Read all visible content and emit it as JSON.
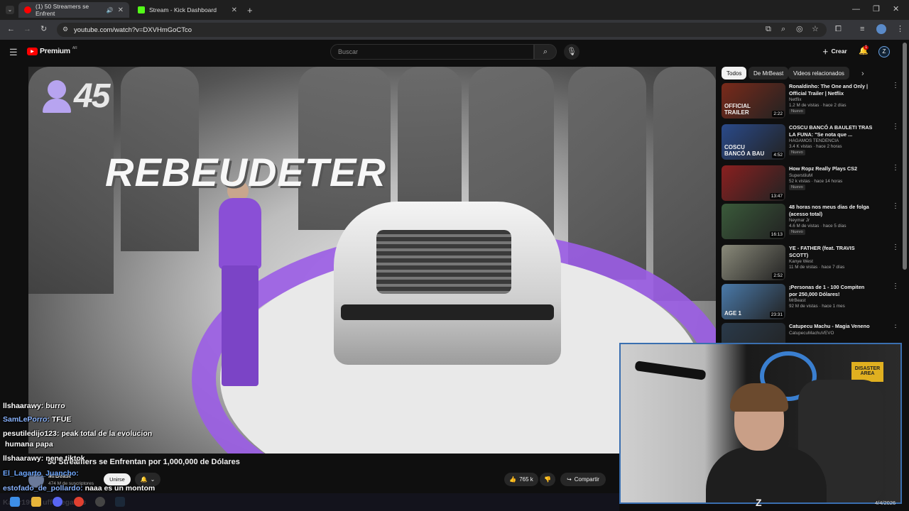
{
  "browser": {
    "tabs": [
      {
        "label": "(1) 50 Streamers se Enfrent",
        "active": true,
        "favicon_color": "#ff0000"
      },
      {
        "label": "Stream - Kick Dashboard",
        "active": false,
        "favicon_color": "#53fc18"
      }
    ],
    "url": "youtube.com/watch?v=DXVHmGoCTco"
  },
  "youtube": {
    "logo_text": "Premium",
    "logo_badge": "AR",
    "search_placeholder": "Buscar",
    "create_label": "Crear",
    "notification_count": "1"
  },
  "video_overlay": {
    "counter": "45",
    "title": "REBEUDETER"
  },
  "chips": [
    {
      "label": "Todos",
      "selected": true
    },
    {
      "label": "De MrBeast",
      "selected": false
    },
    {
      "label": "Videos relacionados",
      "selected": false
    }
  ],
  "recommendations": [
    {
      "title": "Ronaldinho: The One and Only | Official Trailer | Netflix",
      "channel": "Netflix",
      "meta": "1.2 M de vistas · hace 2 días",
      "badge": "Nuevo",
      "duration": "2:22",
      "thumb_text": "OFFICIAL TRAILER",
      "thumb_color": "#7a2a1a"
    },
    {
      "title": "COSCU BANCÓ A BAULETI TRAS LA FUNA: \"Se nota que ...",
      "channel": "HAGAMOS TENDENCIA",
      "meta": "3.4 K vistas · hace 2 horas",
      "badge": "Nuevo",
      "duration": "4:52",
      "thumb_text": "COSCU BANCÓ A BAU",
      "thumb_color": "#2a4a8a"
    },
    {
      "title": "How Ropz Really Plays CS2",
      "channel": "SuperstiluM",
      "meta": "52 k vistas · hace 14 horas",
      "badge": "Nuevo",
      "duration": "13:47",
      "thumb_text": "",
      "thumb_color": "#8a2020"
    },
    {
      "title": "48 horas nos meus dias de folga (acesso total)",
      "channel": "Neymar Jr",
      "meta": "4.6 M de vistas · hace 5 días",
      "badge": "Nuevo",
      "duration": "16:13",
      "thumb_text": "",
      "thumb_color": "#3a5a3a"
    },
    {
      "title": "YE - FATHER (feat. TRAVIS SCOTT)",
      "channel": "Kanye West",
      "meta": "11 M de vistas · hace 7 días",
      "badge": "",
      "duration": "2:52",
      "thumb_text": "",
      "thumb_color": "#8a8a7a"
    },
    {
      "title": "¡Personas de 1 - 100 Compiten por 250,000 Dólares!",
      "channel": "MrBeast",
      "meta": "92 M de vistas · hace 1 mes",
      "badge": "",
      "duration": "23:31",
      "thumb_text": "AGE 1",
      "thumb_color": "#4a7aaa"
    },
    {
      "title": "Catupecu Machu - Magia Veneno",
      "channel": "CatupecuMachuVEVO",
      "meta": "",
      "badge": "",
      "duration": "",
      "thumb_text": "",
      "thumb_color": "#2a3a4a"
    }
  ],
  "chat": [
    {
      "user": "llshaarawy:",
      "msg": "burro",
      "color": "#ffffff"
    },
    {
      "user": "SamLePorro:",
      "msg": "TFUE",
      "color": "#8ab4ff"
    },
    {
      "user": "pesutiledijo123:",
      "msg": "peak total de la evolucion",
      "color": "#ffffff"
    },
    {
      "user": "",
      "msg": "humana papa",
      "color": "#ffffff"
    },
    {
      "user": "llshaarawy:",
      "msg": "nene tiktok",
      "color": "#ffffff"
    },
    {
      "user": "El_Lagarto_Juancho:",
      "msg": "",
      "color": "#6fa8ff"
    },
    {
      "user": "estofado_de_pollardo:",
      "msg": "naaa es un montom",
      "color": "#8ab4ff"
    },
    {
      "user": "Kalar1998:",
      "msg": "uff juegazos",
      "color": "#ffffff"
    }
  ],
  "video_info": {
    "title": "50 Streamers se Enfrentan por 1,000,000 de Dólares",
    "channel": "MrBeast",
    "subscribers": "474 M de suscriptores",
    "join_label": "Unirse",
    "likes": "765 k",
    "share_label": "Compartir"
  },
  "webcam": {
    "sign_text": "DISASTER AREA"
  },
  "clock": {
    "date": "4/4/2026"
  }
}
